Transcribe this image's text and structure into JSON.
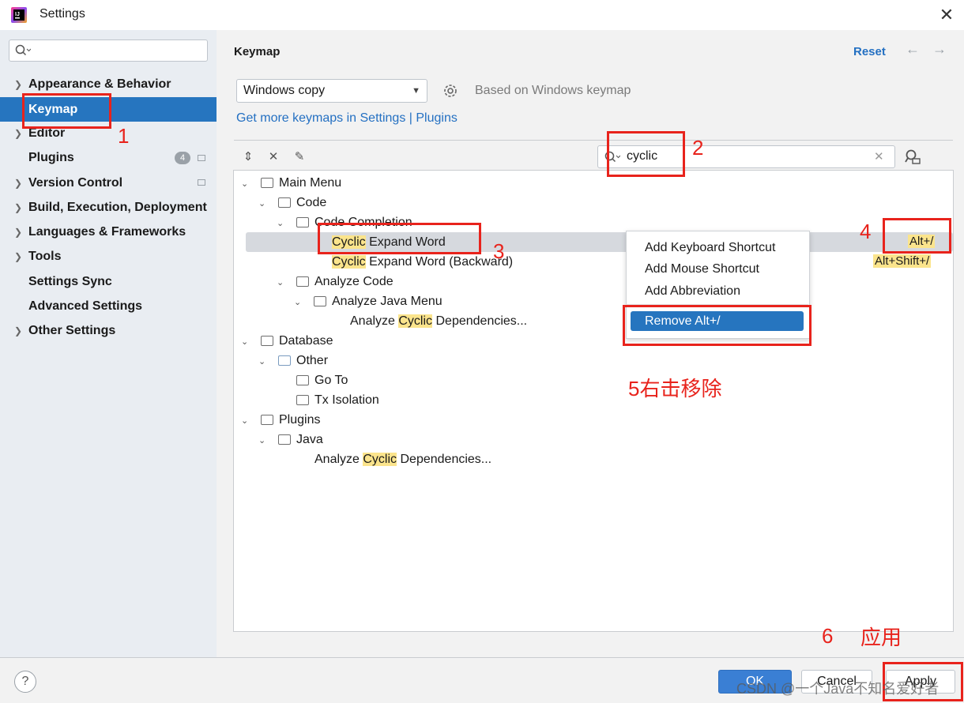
{
  "window": {
    "title": "Settings",
    "close_glyph": "✕"
  },
  "sidebar": {
    "search_placeholder": "",
    "items": [
      {
        "label": "Appearance & Behavior",
        "expandable": true
      },
      {
        "label": "Keymap",
        "expandable": false,
        "active": true
      },
      {
        "label": "Editor",
        "expandable": true
      },
      {
        "label": "Plugins",
        "expandable": false,
        "badge": "4"
      },
      {
        "label": "Version Control",
        "expandable": true
      },
      {
        "label": "Build, Execution, Deployment",
        "expandable": true
      },
      {
        "label": "Languages & Frameworks",
        "expandable": true
      },
      {
        "label": "Tools",
        "expandable": true
      },
      {
        "label": "Settings Sync",
        "expandable": false
      },
      {
        "label": "Advanced Settings",
        "expandable": false
      },
      {
        "label": "Other Settings",
        "expandable": true
      }
    ]
  },
  "main": {
    "title": "Keymap",
    "reset_label": "Reset",
    "keymap_select": "Windows copy",
    "based_on": "Based on Windows keymap",
    "more_link": "Get more keymaps in Settings | Plugins",
    "search_value": "cyclic",
    "tree": {
      "main_menu": "Main Menu",
      "code": "Code",
      "code_completion": "Code Completion",
      "cyclic_expand_word": {
        "hl": "Cyclic",
        "rest": " Expand Word",
        "shortcut": "Alt+/"
      },
      "cyclic_expand_word_back": {
        "hl": "Cyclic",
        "rest": " Expand Word (Backward)",
        "shortcut": "Alt+Shift+/"
      },
      "analyze_code": "Analyze Code",
      "analyze_java_menu": "Analyze Java Menu",
      "analyze_cyclic_1": {
        "pre": "Analyze ",
        "hl": "Cyclic",
        "post": " Dependencies..."
      },
      "database": "Database",
      "other": "Other",
      "go_to": "Go To",
      "tx_isolation": "Tx Isolation",
      "plugins": "Plugins",
      "java": "Java",
      "analyze_cyclic_2": {
        "pre": "Analyze ",
        "hl": "Cyclic",
        "post": " Dependencies..."
      }
    }
  },
  "context_menu": {
    "items": [
      "Add Keyboard Shortcut",
      "Add Mouse Shortcut",
      "Add Abbreviation"
    ],
    "remove": "Remove Alt+/"
  },
  "annotations": {
    "n1": "1",
    "n2": "2",
    "n3": "3",
    "n4": "4",
    "n5": "5右击移除",
    "n6": "6",
    "apply_cn": "应用"
  },
  "footer": {
    "help": "?",
    "ok": "OK",
    "cancel": "Cancel",
    "apply": "Apply",
    "watermark": "CSDN @一个Java不知名爱好者"
  },
  "colors": {
    "accent": "#2675bf",
    "highlight": "#fbe48c",
    "annotation": "#e8231c",
    "link": "#2470c2"
  }
}
